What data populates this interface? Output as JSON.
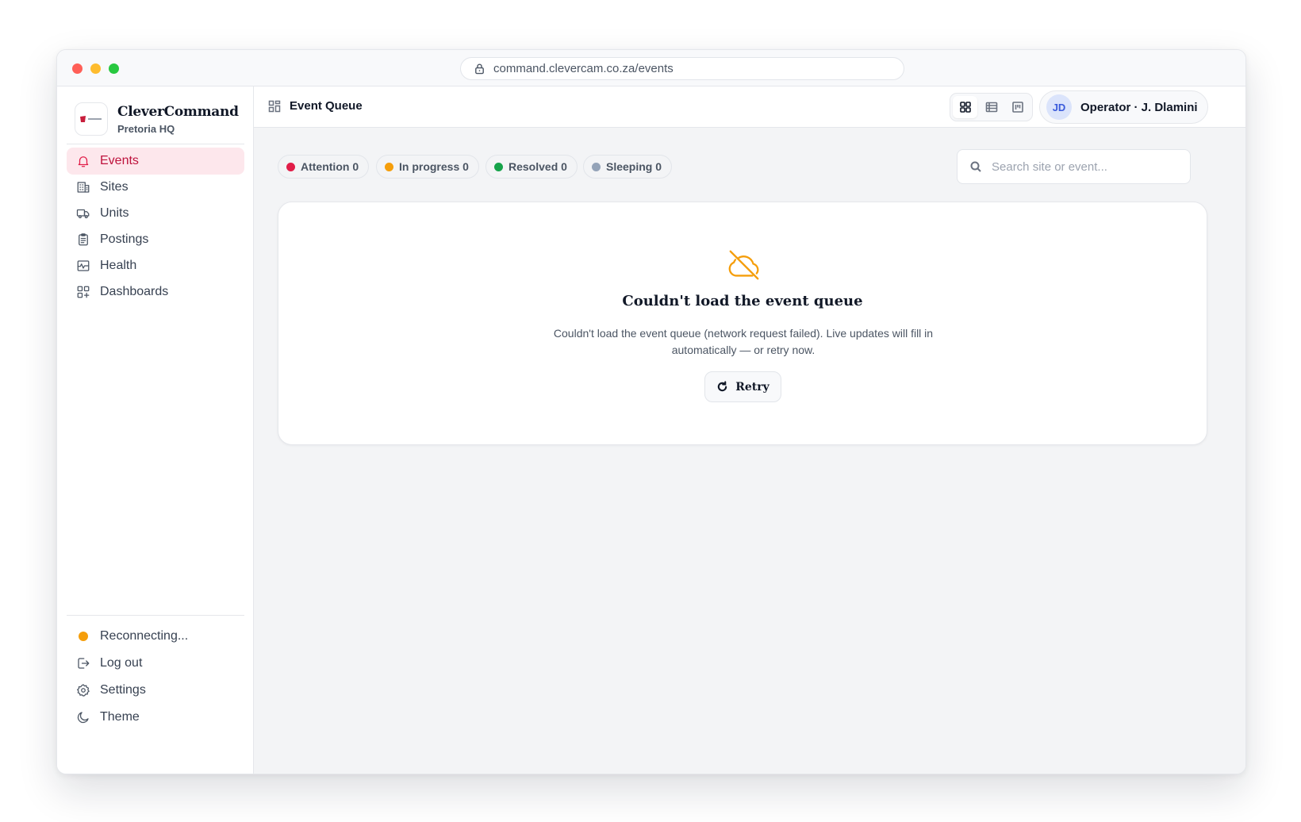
{
  "browser": {
    "url": "command.clevercam.co.za/events"
  },
  "brand": {
    "name": "CleverCommand",
    "subtitle": "Pretoria HQ"
  },
  "sidebar": {
    "items": [
      {
        "label": "Events",
        "icon": "bell-icon",
        "active": true
      },
      {
        "label": "Sites",
        "icon": "building-icon"
      },
      {
        "label": "Units",
        "icon": "truck-icon"
      },
      {
        "label": "Postings",
        "icon": "clipboard-icon"
      },
      {
        "label": "Health",
        "icon": "activity-icon"
      },
      {
        "label": "Dashboards",
        "icon": "dashboard-icon"
      }
    ],
    "footer": {
      "status": "Reconnecting...",
      "logout": "Log out",
      "settings": "Settings",
      "theme": "Theme"
    }
  },
  "header": {
    "title": "Event Queue",
    "views": [
      "grid-view-icon",
      "list-view-icon",
      "board-view-icon"
    ],
    "user": {
      "initials": "JD",
      "name": "Operator · J. Dlamini"
    }
  },
  "filters": [
    {
      "label": "Attention 0",
      "color": "#e11d48"
    },
    {
      "label": "In progress 0",
      "color": "#f59e0b"
    },
    {
      "label": "Resolved 0",
      "color": "#16a34a"
    },
    {
      "label": "Sleeping 0",
      "color": "#94a3b8"
    }
  ],
  "search": {
    "placeholder": "Search site or event..."
  },
  "error": {
    "title": "Couldn't load the event queue",
    "message": "Couldn't load the event queue (network request failed). Live updates will fill in automatically — or retry now.",
    "retry_label": "Retry"
  },
  "colors": {
    "accent": "#e11d48",
    "warning": "#f59e0b"
  }
}
